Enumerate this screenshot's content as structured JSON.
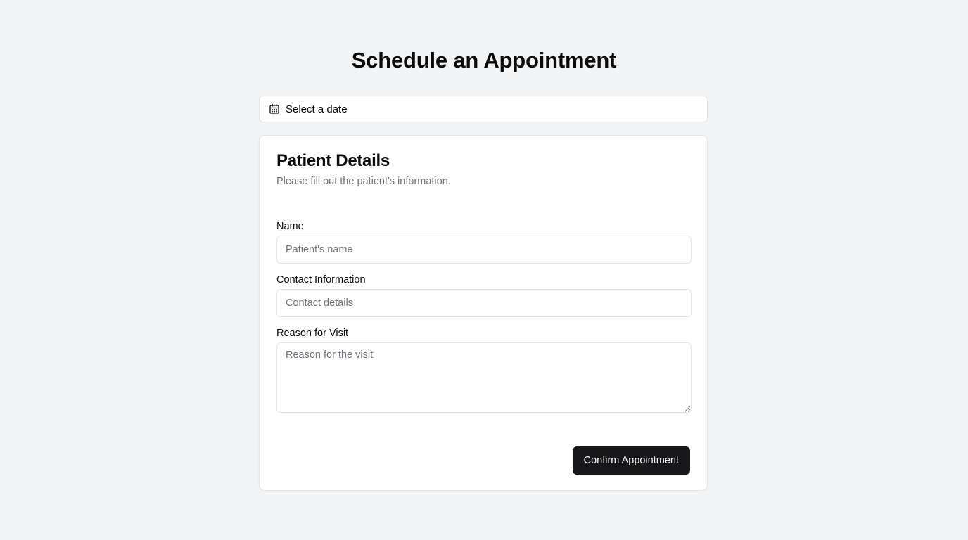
{
  "page": {
    "title": "Schedule an Appointment"
  },
  "date_picker": {
    "icon": "calendar-icon",
    "label": "Select a date"
  },
  "card": {
    "title": "Patient Details",
    "description": "Please fill out the patient's information.",
    "fields": {
      "name": {
        "label": "Name",
        "placeholder": "Patient's name",
        "value": ""
      },
      "contact": {
        "label": "Contact Information",
        "placeholder": "Contact details",
        "value": ""
      },
      "reason": {
        "label": "Reason for Visit",
        "placeholder": "Reason for the visit",
        "value": ""
      }
    },
    "submit_label": "Confirm Appointment"
  },
  "colors": {
    "background": "#f2f3f5",
    "card_background": "#ffffff",
    "border": "#e4e4e7",
    "muted_text": "#71717a",
    "primary_button": "#18181b",
    "primary_button_text": "#fafafa"
  }
}
